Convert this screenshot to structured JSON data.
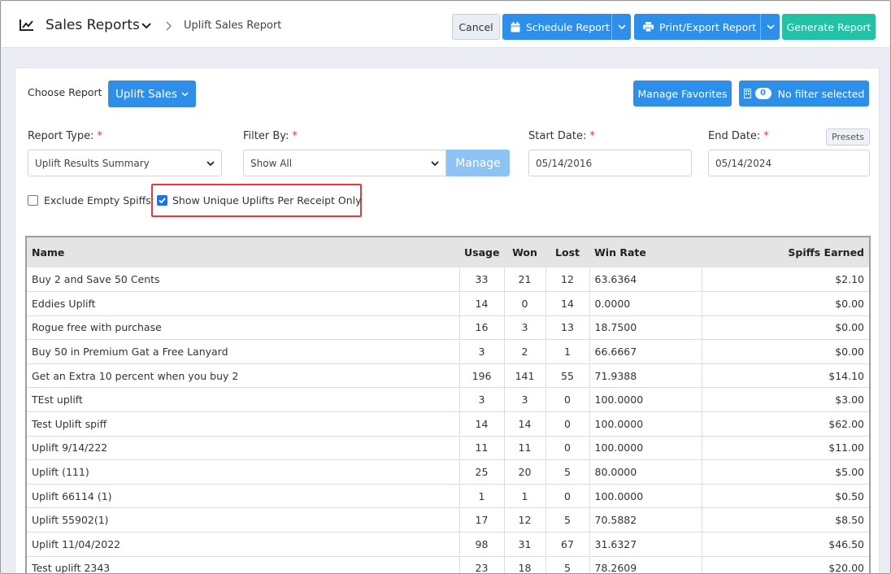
{
  "header": {
    "app_title": "Sales Reports",
    "breadcrumb_current": "Uplift Sales Report",
    "cancel_label": "Cancel",
    "schedule_label": "Schedule Report",
    "print_label": "Print/Export Report",
    "generate_label": "Generate Report"
  },
  "controls": {
    "choose_report_label": "Choose Report",
    "choose_report_value": "Uplift Sales",
    "manage_favorites_label": "Manage Favorites",
    "filter_count": "0",
    "filter_label": "No filter selected",
    "report_type_label": "Report Type:",
    "report_type_value": "Uplift Results Summary",
    "filter_by_label": "Filter By:",
    "filter_by_value": "Show All",
    "manage_label": "Manage",
    "start_date_label": "Start Date:",
    "start_date_value": "05/14/2016",
    "end_date_label": "End Date:",
    "end_date_value": "05/14/2024",
    "presets_label": "Presets",
    "required_marker": "*",
    "exclude_empty_label": "Exclude Empty Spiffs",
    "exclude_empty_checked": false,
    "unique_uplifts_label": "Show Unique Uplifts Per Receipt Only",
    "unique_uplifts_checked": true
  },
  "table": {
    "headers": [
      "Name",
      "Usage",
      "Won",
      "Lost",
      "Win Rate",
      "Spiffs Earned"
    ],
    "rows": [
      [
        "Buy 2 and Save 50 Cents",
        "33",
        "21",
        "12",
        "63.6364",
        "$2.10"
      ],
      [
        "Eddies Uplift",
        "14",
        "0",
        "14",
        "0.0000",
        "$0.00"
      ],
      [
        "Rogue free with purchase",
        "16",
        "3",
        "13",
        "18.7500",
        "$0.00"
      ],
      [
        "Buy 50 in Premium Gat a Free Lanyard",
        "3",
        "2",
        "1",
        "66.6667",
        "$0.00"
      ],
      [
        "Get an Extra 10 percent when you buy 2",
        "196",
        "141",
        "55",
        "71.9388",
        "$14.10"
      ],
      [
        "TEst uplift",
        "3",
        "3",
        "0",
        "100.0000",
        "$3.00"
      ],
      [
        "Test Uplift spiff",
        "14",
        "14",
        "0",
        "100.0000",
        "$62.00"
      ],
      [
        "Uplift 9/14/222",
        "11",
        "11",
        "0",
        "100.0000",
        "$11.00"
      ],
      [
        "Uplift (111)",
        "25",
        "20",
        "5",
        "80.0000",
        "$5.00"
      ],
      [
        "Uplift 66114 (1)",
        "1",
        "1",
        "0",
        "100.0000",
        "$0.50"
      ],
      [
        "Uplift 55902(1)",
        "17",
        "12",
        "5",
        "70.5882",
        "$8.50"
      ],
      [
        "Uplift 11/04/2022",
        "98",
        "31",
        "67",
        "31.6327",
        "$46.50"
      ],
      [
        "Test uplift 2343",
        "23",
        "18",
        "5",
        "78.2609",
        "$20.00"
      ]
    ]
  },
  "colors": {
    "primary": "#2e8fea",
    "success": "#23c1a5",
    "highlight": "#e03a3a"
  }
}
